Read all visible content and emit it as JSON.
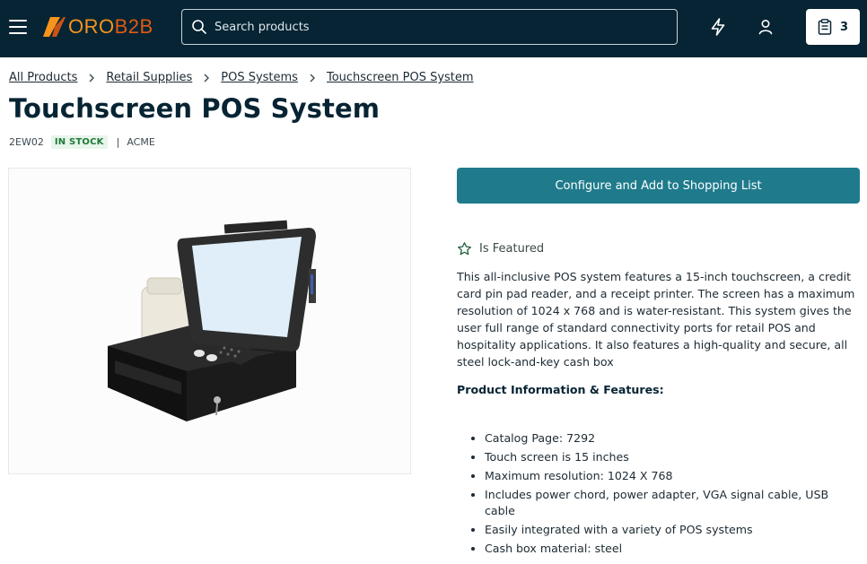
{
  "header": {
    "logo": {
      "part1": "ORO",
      "part2": "B2B",
      "accent": "#f7941d",
      "accent2": "#e05a12"
    },
    "search_placeholder": "Search products",
    "cart_count": "3",
    "background": "#062433"
  },
  "breadcrumb": [
    "All Products",
    "Retail Supplies",
    "POS Systems",
    "Touchscreen POS System"
  ],
  "product": {
    "title": "Touchscreen POS System",
    "sku": "2EW02",
    "stock": "IN STOCK",
    "brand": "ACME",
    "cta_label": "Configure and Add to Shopping List",
    "featured_label": "Is Featured",
    "description": "This all-inclusive POS system features a 15-inch touchscreen, a credit card pin pad reader, and a receipt printer. The screen has a maximum resolution of 1024 x 768 and is water-resistant. This system gives the user full range of standard connectivity ports for retail POS and hospitality applications. It also features a high-quality and secure, all steel lock-and-key cash box",
    "features_heading": "Product Information & Features:",
    "features": [
      "Catalog Page: 7292",
      "Touch screen is 15 inches",
      "Maximum resolution: 1024 X 768",
      "Includes power chord, power adapter, VGA signal cable, USB cable",
      "Easily integrated with a variety of POS systems",
      "Cash box material: steel"
    ]
  },
  "icons": [
    "menu-icon",
    "search-icon",
    "lightning-icon",
    "user-icon",
    "clipboard-icon",
    "chevron-right-icon",
    "star-icon"
  ],
  "colors": {
    "cta": "#1f7b8c",
    "stock_bg": "#e7f5ea",
    "stock_text": "#1f7a38"
  }
}
